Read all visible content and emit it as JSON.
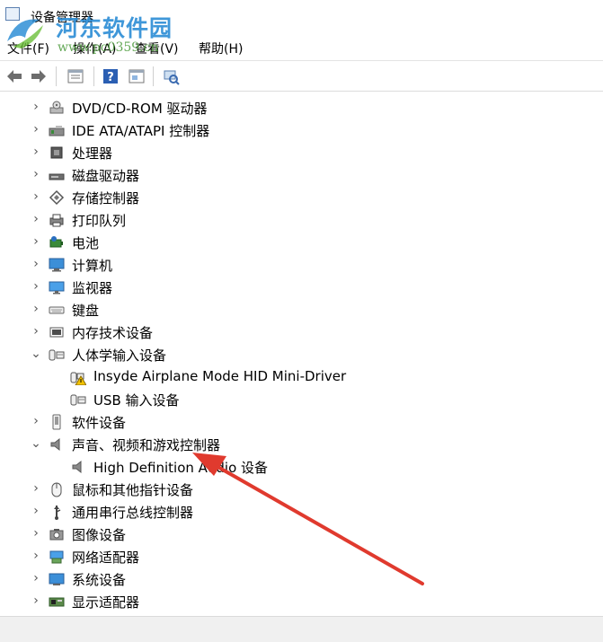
{
  "window": {
    "title": "设备管理器"
  },
  "watermark": {
    "brand": "河东软件园",
    "url": "www.pc0359.cn"
  },
  "menu": {
    "file": "文件(F)",
    "action": "操作(A)",
    "view": "查看(V)",
    "help": "帮助(H)"
  },
  "toolbar": {
    "icons": [
      "back-arrow-icon",
      "forward-arrow-icon",
      "properties-icon",
      "help-icon",
      "update-driver-icon",
      "scan-hardware-icon"
    ]
  },
  "tree": {
    "items": [
      {
        "label": "DVD/CD-ROM 驱动器",
        "level": 0,
        "expanded": false,
        "icon": "dvd-drive-icon"
      },
      {
        "label": "IDE ATA/ATAPI 控制器",
        "level": 0,
        "expanded": false,
        "icon": "ide-controller-icon"
      },
      {
        "label": "处理器",
        "level": 0,
        "expanded": false,
        "icon": "processor-icon"
      },
      {
        "label": "磁盘驱动器",
        "level": 0,
        "expanded": false,
        "icon": "disk-drive-icon"
      },
      {
        "label": "存储控制器",
        "level": 0,
        "expanded": false,
        "icon": "storage-controller-icon"
      },
      {
        "label": "打印队列",
        "level": 0,
        "expanded": false,
        "icon": "printer-icon"
      },
      {
        "label": "电池",
        "level": 0,
        "expanded": false,
        "icon": "battery-icon"
      },
      {
        "label": "计算机",
        "level": 0,
        "expanded": false,
        "icon": "computer-icon"
      },
      {
        "label": "监视器",
        "level": 0,
        "expanded": false,
        "icon": "monitor-icon"
      },
      {
        "label": "键盘",
        "level": 0,
        "expanded": false,
        "icon": "keyboard-icon"
      },
      {
        "label": "内存技术设备",
        "level": 0,
        "expanded": false,
        "icon": "memory-device-icon"
      },
      {
        "label": "人体学输入设备",
        "level": 0,
        "expanded": true,
        "icon": "hid-icon"
      },
      {
        "label": "Insyde Airplane Mode HID Mini-Driver",
        "level": 1,
        "icon": "hid-warning-icon"
      },
      {
        "label": "USB 输入设备",
        "level": 1,
        "icon": "hid-icon"
      },
      {
        "label": "软件设备",
        "level": 0,
        "expanded": false,
        "icon": "software-device-icon"
      },
      {
        "label": "声音、视频和游戏控制器",
        "level": 0,
        "expanded": true,
        "icon": "speaker-icon"
      },
      {
        "label": "High Definition Audio 设备",
        "level": 1,
        "icon": "speaker-icon"
      },
      {
        "label": "鼠标和其他指针设备",
        "level": 0,
        "expanded": false,
        "icon": "mouse-icon"
      },
      {
        "label": "通用串行总线控制器",
        "level": 0,
        "expanded": false,
        "icon": "usb-icon"
      },
      {
        "label": "图像设备",
        "level": 0,
        "expanded": false,
        "icon": "camera-icon"
      },
      {
        "label": "网络适配器",
        "level": 0,
        "expanded": false,
        "icon": "network-adapter-icon"
      },
      {
        "label": "系统设备",
        "level": 0,
        "expanded": false,
        "icon": "system-device-icon"
      },
      {
        "label": "显示适配器",
        "level": 0,
        "expanded": false,
        "icon": "display-adapter-icon"
      }
    ]
  },
  "colors": {
    "accent": "#1e7fd0",
    "annotation_arrow": "#e03a2e",
    "watermark": "#2f8fd6"
  }
}
